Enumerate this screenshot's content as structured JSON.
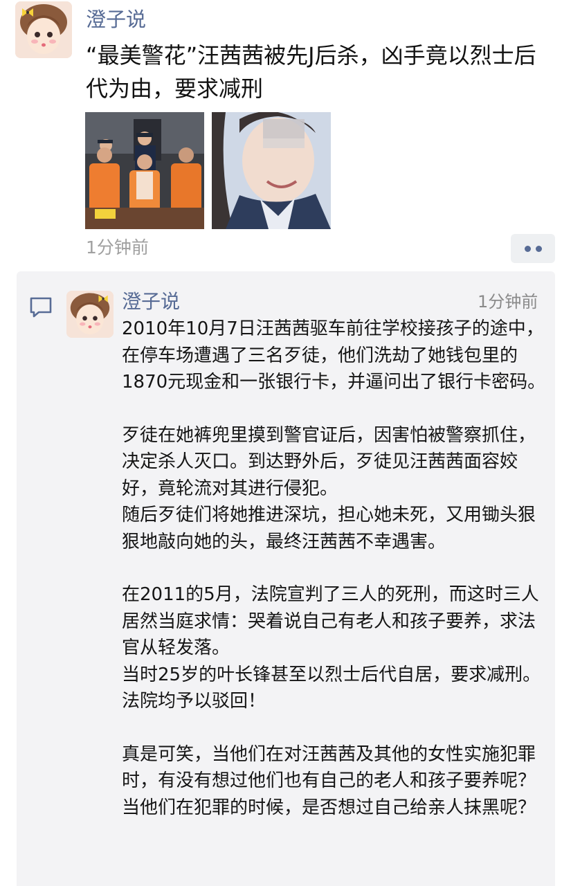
{
  "post": {
    "author": "澄子说",
    "text": "“最美警花”汪茜茜被先J后杀，凶手竟以烈士后代为由，要求减刑",
    "time": "1分钟前",
    "photos": [
      "photo-courtroom",
      "photo-portrait"
    ],
    "more_icon": "more-dots-icon"
  },
  "comment": {
    "icon": "comment-icon",
    "author": "澄子说",
    "time": "1分钟前",
    "paragraphs": [
      [
        "2010年10月7日汪茜茜驱车前往学校接孩子的途中，在停车场遭遇了三名歹徒，他们洗劫了她钱包里的1870元现金和一张银行卡，并逼问出了银行卡密码。"
      ],
      [
        "歹徒在她裤兜里摸到警官证后，因害怕被警察抓住，决定杀人灭口。到达野外后，歹徒见汪茜茜面容姣好，竟轮流对其进行侵犯。",
        "随后歹徒们将她推进深坑，担心她未死，又用锄头狠狠地敲向她的头，最终汪茜茜不幸遇害。"
      ],
      [
        "在2011的5月，法院宣判了三人的死刑，而这时三人居然当庭求情：哭着说自己有老人和孩子要养，求法官从轻发落。",
        "当时25岁的叶长锋甚至以烈士后代自居，要求减刑。法院均予以驳回！"
      ],
      [
        "真是可笑，当他们在对汪茜茜及其他的女性实施犯罪时，有没有想过他们也有自己的老人和孩子要养呢？当他们在犯罪的时候，是否想过自己给亲人抹黑呢？"
      ]
    ]
  },
  "colors": {
    "name": "#576b95",
    "panel": "#f3f3f5",
    "time": "#a0a0a0"
  }
}
